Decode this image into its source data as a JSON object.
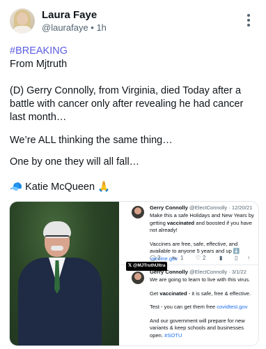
{
  "author": {
    "name": "Laura Faye",
    "handle_time": "@laurafaye • 1h"
  },
  "post": {
    "hashtag": "#BREAKING",
    "line1": "From Mjtruth",
    "para1": "(D) Gerry Connolly, from Virginia, died Today after a battle with cancer only after revealing he had cancer last month…",
    "para2": "We’re ALL thinking the same thing…",
    "para3": "One by one they will all fall…",
    "signature": "🧢 Katie McQueen 🙏"
  },
  "media": {
    "watermark": "@MJTruthUltra",
    "tweet1": {
      "name": "Gerry Connolly",
      "meta": "@ElectConnolly · 12/20/21",
      "p1_a": "Make this a safe Holidays and New Years by getting ",
      "p1_bold": "vaccinated",
      "p1_b": " and boosted if you have not already!",
      "p2_a": "Vaccines are free, safe, effective, and available to anyone 5 years and up ",
      "p2_icon": "⬇️",
      "p2_link": "vaccine.gov",
      "replies": "3",
      "retweets": "1",
      "likes": "2"
    },
    "tweet2": {
      "name": "Gerry Connolly",
      "meta": "@ElectConnolly · 3/1/22",
      "p1": "We are going to learn to live with this virus.",
      "p2_a": "Get ",
      "p2_bold": "vaccinated",
      "p2_b": " - it is safe, free & effective.",
      "p3_a": "Test - you can get them free ",
      "p3_link": "covidtest.gov",
      "p4": "And our government will prepare for new variants & keep schools and businesses open.",
      "p4_tag": "#SOTU"
    }
  }
}
